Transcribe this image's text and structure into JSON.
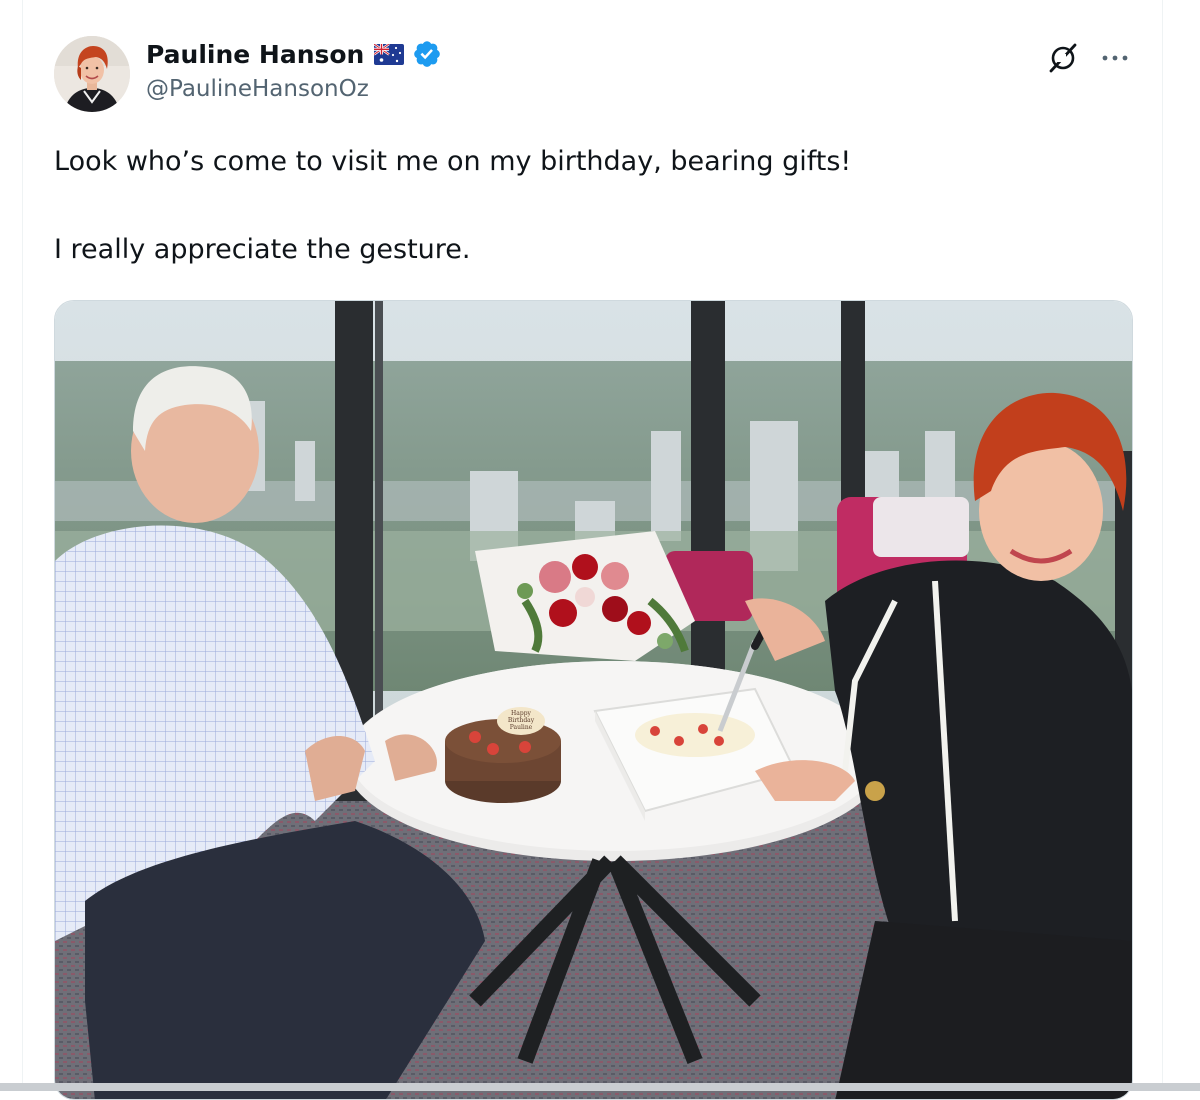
{
  "author": {
    "display_name": "Pauline Hanson",
    "flag_emoji": "🇦🇺",
    "handle": "@PaulineHansonOz",
    "verified": true,
    "verified_color": "#1d9bf0"
  },
  "actions": {
    "grok_icon": "grok-icon",
    "more_icon": "more-icon"
  },
  "tweet": {
    "line1": "Look who’s come to visit me on my birthday, bearing gifts!",
    "line2": "I really appreciate the gesture."
  },
  "media": {
    "cake_topper_text": [
      "Happy",
      "Birthday",
      "Pauline"
    ]
  },
  "colors": {
    "text_primary": "#0f1419",
    "text_secondary": "#536471",
    "border": "#cfd9de"
  }
}
